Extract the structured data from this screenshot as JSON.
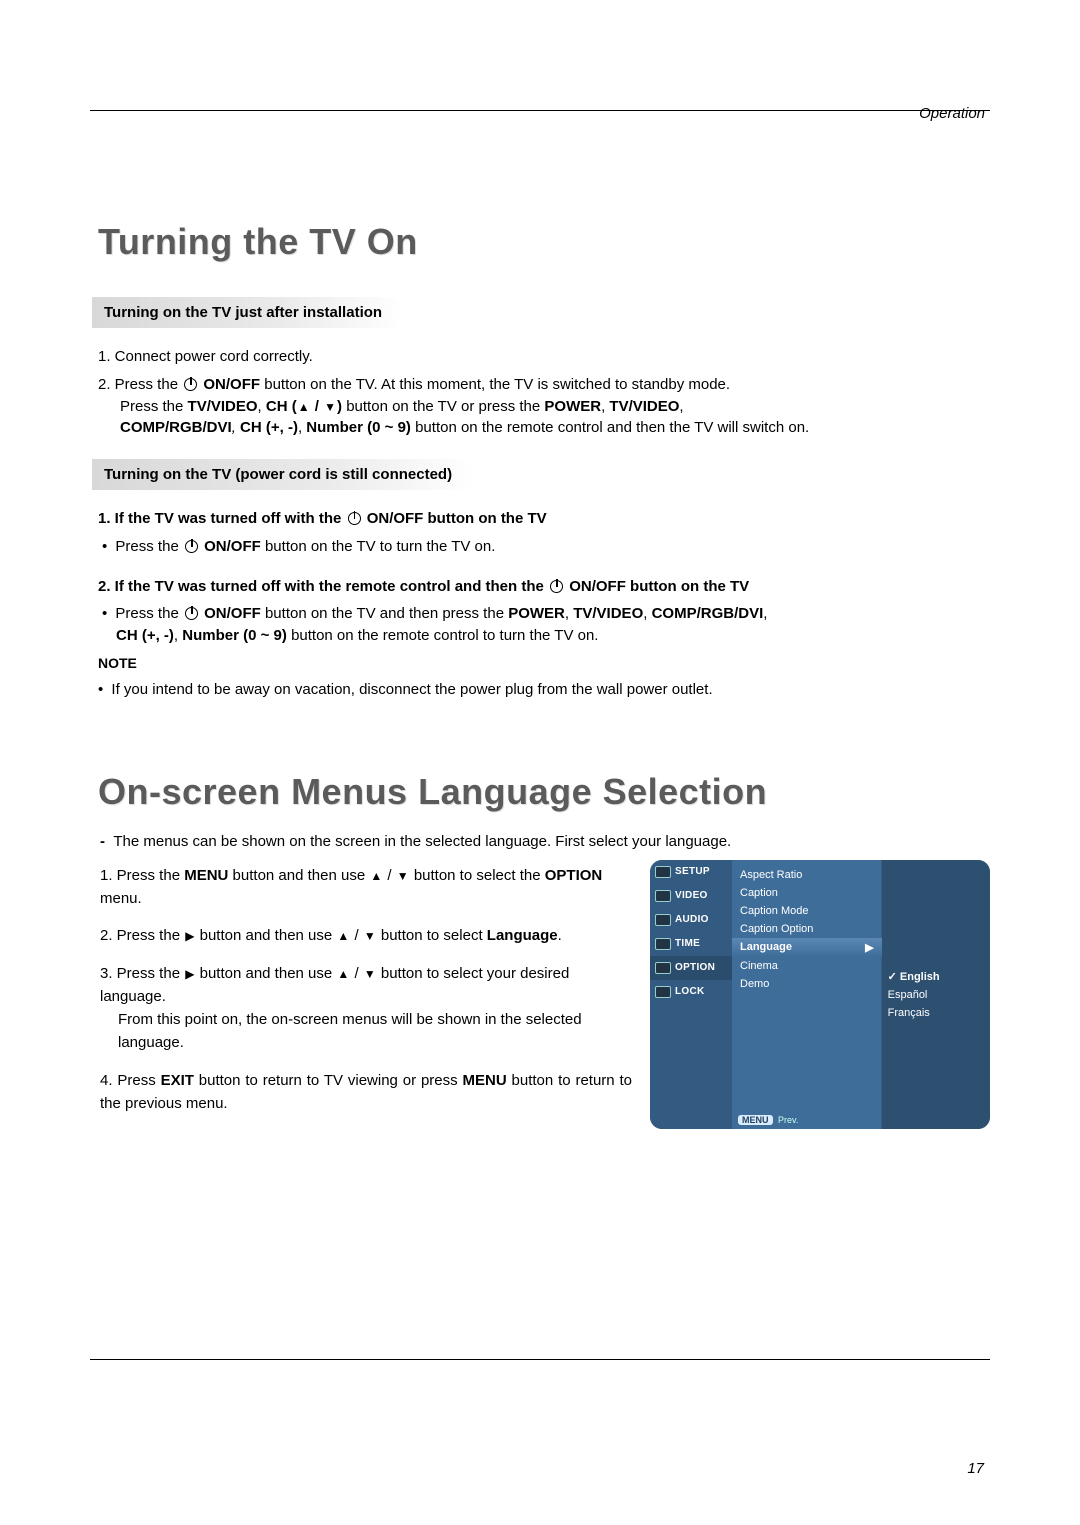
{
  "category": "Operation",
  "page_number": "17",
  "section1": {
    "title": "Turning the TV On",
    "subhdr1": "Turning on the TV just after installation",
    "step1": "1. Connect power cord correctly.",
    "step2_prefix": "2. Press the ",
    "onoff": "ON/OFF",
    "step2_mid": " button on the TV. At this moment, the TV is switched to standby mode.",
    "step2_line2_prefix": "Press the ",
    "tvvideo": "TV/VIDEO",
    "ch_label": "CH",
    "step2_line2_mid": " button on the TV or press the ",
    "power": "POWER",
    "step2_line3_prefix": "COMP/RGB/DVI",
    "ch_pm": "CH (+,  -)",
    "number09": "Number (0 ~ 9)",
    "step2_line3_suffix": " button on the remote control and then the TV will switch on.",
    "subhdr2": "Turning on the TV (power cord is still connected)",
    "case1_hdr": "1. If the TV was turned off with the ",
    "case1_hdr_suffix": " ON/OFF button on the TV",
    "case1_body_prefix": "Press the ",
    "case1_body_suffix": " button on the TV to turn the TV on.",
    "case2_hdr": "2. If the TV was turned off  with the remote control and then the ",
    "case2_hdr_suffix": " ON/OFF button on the TV",
    "case2_body_prefix": "Press the ",
    "case2_body_mid": " button on the TV and then press the ",
    "case2_body_suffix": " button on the remote control to turn the TV on.",
    "note_hdr": "NOTE",
    "note_body": "If you intend to be away on vacation, disconnect the power plug from the wall power outlet."
  },
  "section2": {
    "title": "On-screen Menus Language Selection",
    "intro": "The menus can be shown on the screen in the selected language. First select your language.",
    "step1_a": "1. Press the ",
    "menu_btn": "MENU",
    "step1_b": " button and then use ",
    "step1_c": " button to select the ",
    "option_word": "OPTION",
    "step1_d": " menu.",
    "step2_a": "2. Press the ",
    "step2_b": " button and then use ",
    "step2_c": " button to select ",
    "language_word": "Language",
    "period": ".",
    "step3_a": "3. Press the ",
    "step3_b": " button and then use ",
    "step3_c": " button to select your desired language.",
    "step3_line2": "From this point on, the on-screen menus will be shown in the selected language.",
    "step4_a": "4. Press ",
    "exit_btn": "EXIT",
    "step4_b": " button to return to TV viewing or press ",
    "step4_c": " button to return to the previous menu."
  },
  "menu": {
    "side": [
      "SETUP",
      "VIDEO",
      "AUDIO",
      "TIME",
      "OPTION",
      "LOCK"
    ],
    "opts": [
      "Aspect Ratio",
      "Caption",
      "Caption Mode",
      "Caption Option",
      "Language",
      "Cinema",
      "Demo"
    ],
    "langs": [
      "English",
      "Español",
      "Français"
    ],
    "hint_btn": "MENU",
    "hint_txt": "Prev."
  }
}
